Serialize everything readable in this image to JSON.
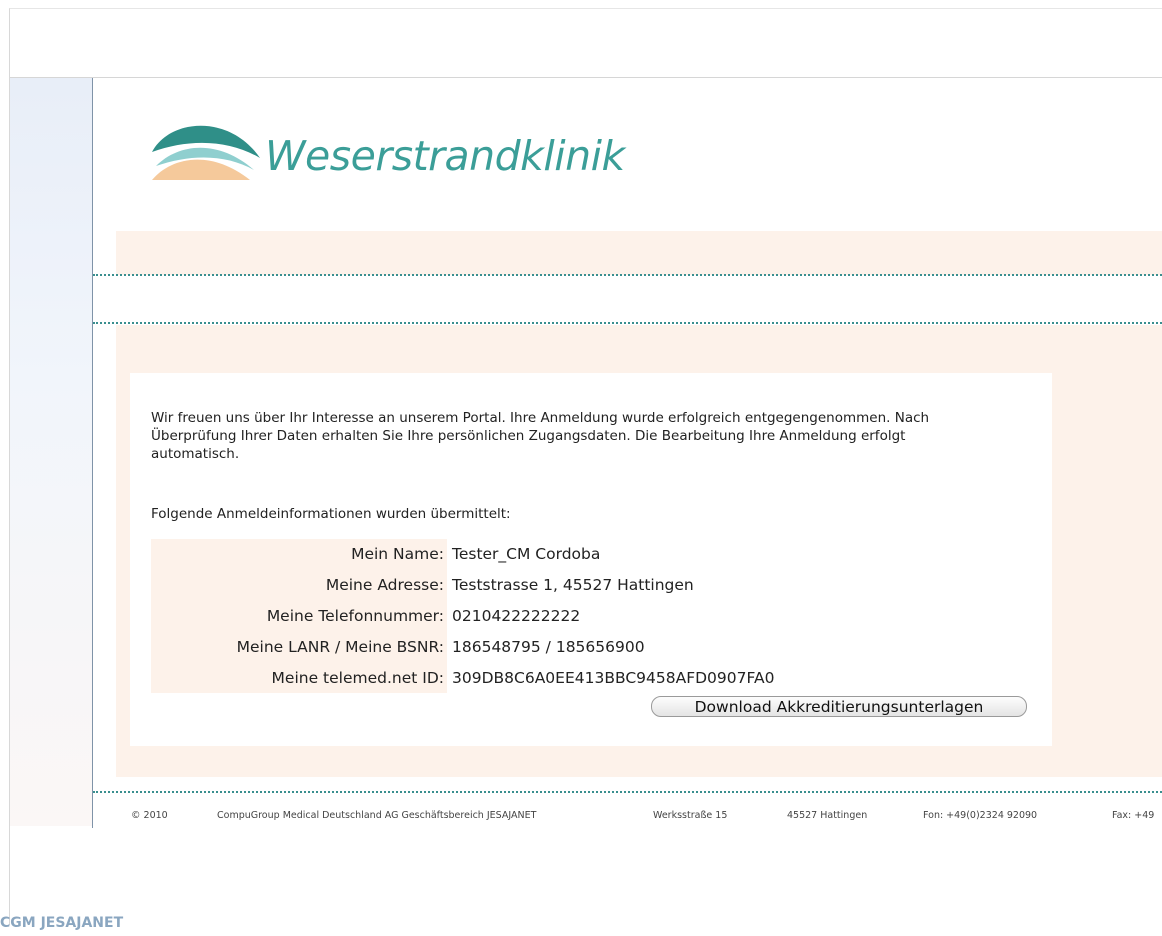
{
  "brand": {
    "name": "Weserstrandklinik",
    "colors": {
      "teal": "#3b9e98",
      "peach": "#fdf2ea",
      "light_peach": "#f5c99b"
    }
  },
  "intro_text": "Wir freuen uns über Ihr Interesse an unserem Portal. Ihre Anmeldung wurde erfolgreich entgegengenommen. Nach Überprüfung Ihrer Daten erhalten Sie Ihre persönlichen Zugangsdaten. Die Bearbeitung Ihre Anmeldung erfolgt automatisch.",
  "subheading": "Folgende Anmeldeinformationen wurden übermittelt:",
  "info": [
    {
      "label": "Mein Name:",
      "value": "Tester_CM Cordoba"
    },
    {
      "label": "Meine Adresse:",
      "value": "Teststrasse 1, 45527 Hattingen"
    },
    {
      "label": "Meine Telefonnummer:",
      "value": "0210422222222"
    },
    {
      "label": "Meine LANR / Meine BSNR:",
      "value": "186548795 / 185656900"
    },
    {
      "label": "Meine telemed.net ID:",
      "value": "309DB8C6A0EE413BBC9458AFD0907FA0"
    }
  ],
  "download_button": "Download Akkreditierungsunterlagen",
  "footer": {
    "copyright": "© 2010",
    "company": "CompuGroup Medical Deutschland AG Geschäftsbereich JESAJANET",
    "street": "Werksstraße 15",
    "city": "45527 Hattingen",
    "phone": "Fon: +49(0)2324 92090",
    "fax": "Fax: +49"
  },
  "watermark": "CGM JESAJANET"
}
